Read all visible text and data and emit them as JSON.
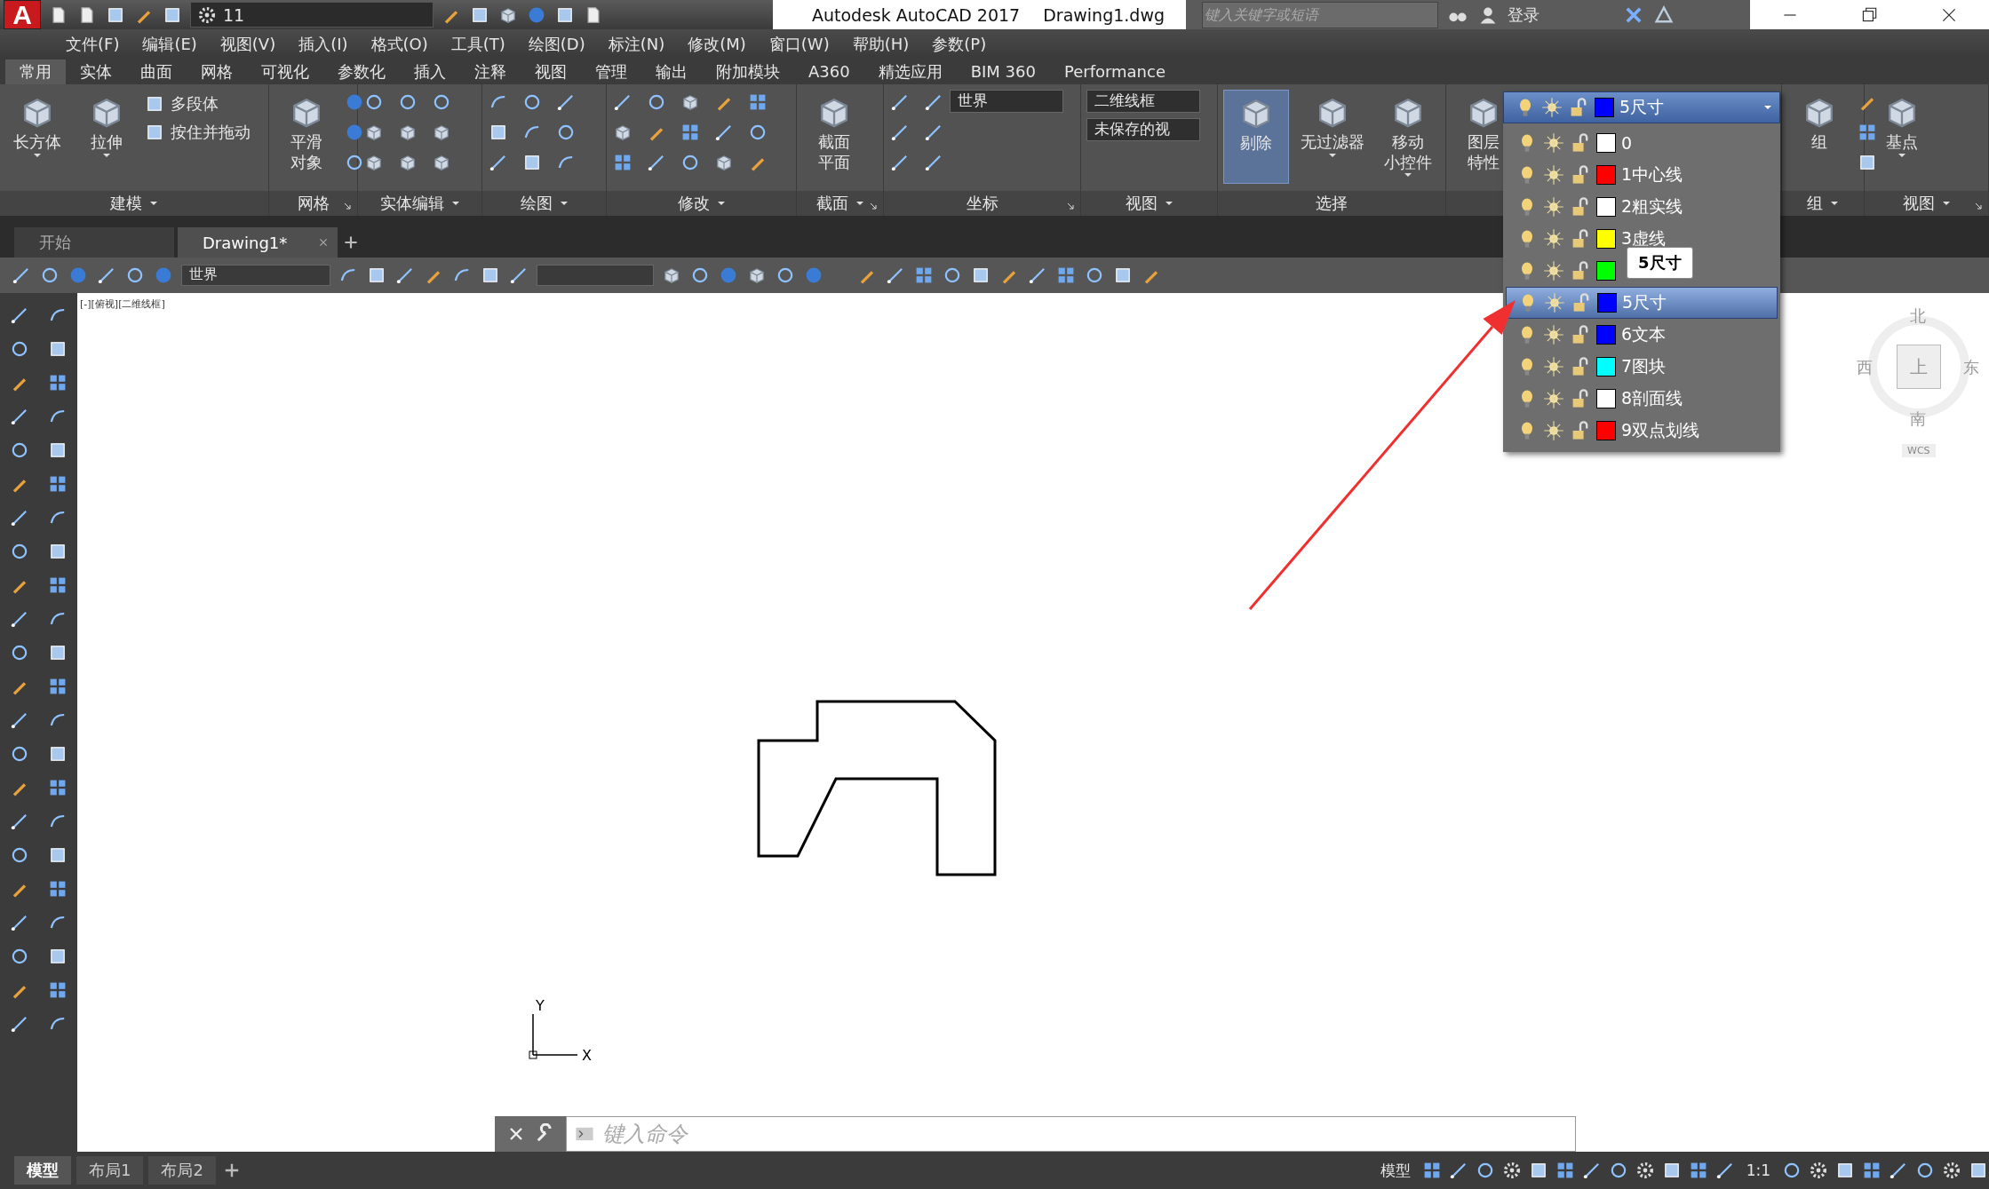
{
  "title_bar": {
    "logo": "A",
    "workspace": "11",
    "app_title": "Autodesk AutoCAD 2017",
    "document": "Drawing1.dwg",
    "search": {
      "placeholder": "键入关键字或短语"
    },
    "user": "登录"
  },
  "menu": [
    "文件(F)",
    "编辑(E)",
    "视图(V)",
    "插入(I)",
    "格式(O)",
    "工具(T)",
    "绘图(D)",
    "标注(N)",
    "修改(M)",
    "窗口(W)",
    "帮助(H)",
    "参数(P)"
  ],
  "ribbon_tabs": [
    {
      "label": "常用",
      "selected": true
    },
    {
      "label": "实体",
      "selected": false
    },
    {
      "label": "曲面",
      "selected": false
    },
    {
      "label": "网格",
      "selected": false
    },
    {
      "label": "可视化",
      "selected": false
    },
    {
      "label": "参数化",
      "selected": false
    },
    {
      "label": "插入",
      "selected": false
    },
    {
      "label": "注释",
      "selected": false
    },
    {
      "label": "视图",
      "selected": false
    },
    {
      "label": "管理",
      "selected": false
    },
    {
      "label": "输出",
      "selected": false
    },
    {
      "label": "附加模块",
      "selected": false
    },
    {
      "label": "A360",
      "selected": false
    },
    {
      "label": "精选应用",
      "selected": false
    },
    {
      "label": "BIM 360",
      "selected": false
    },
    {
      "label": "Performance",
      "selected": false
    }
  ],
  "ribbon_panels": [
    {
      "kind": "modeling",
      "title": "建模",
      "dropdown": true,
      "launcher": false,
      "large": [
        {
          "lines": [
            "长方体"
          ],
          "active": false,
          "caret": true
        },
        {
          "lines": [
            "拉伸"
          ],
          "active": false,
          "caret": true
        }
      ],
      "small": [
        "多段体",
        "按住并拖动"
      ]
    },
    {
      "kind": "mesh",
      "title": "网格",
      "dropdown": false,
      "launcher": true,
      "large": [
        {
          "lines": [
            "平滑",
            "对象"
          ],
          "active": false,
          "caret": false
        }
      ]
    },
    {
      "kind": "solid-edit",
      "title": "实体编辑",
      "dropdown": true,
      "launcher": false
    },
    {
      "kind": "draw",
      "title": "绘图",
      "dropdown": true,
      "launcher": false
    },
    {
      "kind": "modify",
      "title": "修改",
      "dropdown": true,
      "launcher": false
    },
    {
      "kind": "section",
      "title": "截面",
      "dropdown": true,
      "launcher": true,
      "large": [
        {
          "lines": [
            "截面",
            "平面"
          ],
          "active": false,
          "caret": false
        }
      ]
    },
    {
      "kind": "coords",
      "title": "坐标",
      "dropdown": false,
      "launcher": true,
      "selects": [
        "世界"
      ]
    },
    {
      "kind": "view",
      "title": "视图",
      "dropdown": true,
      "launcher": false,
      "selects": [
        "二维线框",
        "未保存的视"
      ]
    },
    {
      "kind": "selection",
      "title": "选择",
      "dropdown": false,
      "launcher": false,
      "large": [
        {
          "lines": [
            "剔除"
          ],
          "active": true,
          "caret": false
        },
        {
          "lines": [
            "无过滤器"
          ],
          "active": false,
          "caret": true
        },
        {
          "lines": [
            "移动",
            "小控件"
          ],
          "active": false,
          "caret": true
        }
      ]
    },
    {
      "kind": "layers",
      "large": [
        {
          "lines": [
            "图层",
            "特性"
          ],
          "active": false,
          "caret": false
        }
      ]
    },
    {
      "kind": "group",
      "title": "组",
      "dropdown": true,
      "launcher": false,
      "large": [
        {
          "lines": [
            "组"
          ],
          "active": false,
          "caret": false
        }
      ]
    },
    {
      "kind": "view-block",
      "title": "视图",
      "dropdown": true,
      "launcher": true,
      "large": [
        {
          "lines": [
            "基点"
          ],
          "active": false,
          "caret": true
        }
      ]
    }
  ],
  "layer_control": {
    "current": {
      "name": "5尺寸",
      "color": "#0000ff"
    },
    "layers": [
      {
        "name": "0",
        "color": "#ffffff",
        "selected": false
      },
      {
        "name": "1中心线",
        "color": "#ff0000",
        "selected": false
      },
      {
        "name": "2粗实线",
        "color": "#ffffff",
        "selected": false
      },
      {
        "name": "3虚线",
        "color": "#ffff00",
        "selected": false
      },
      {
        "color": "#00ff00",
        "selected": false
      },
      {
        "name": "5尺寸",
        "color": "#0000ff",
        "selected": true
      },
      {
        "name": "6文本",
        "color": "#0000ff",
        "selected": false
      },
      {
        "name": "7图块",
        "color": "#00ffff",
        "selected": false
      },
      {
        "name": "8剖面线",
        "color": "#ffffff",
        "selected": false
      },
      {
        "name": "9双点划线",
        "color": "#ff0000",
        "selected": false
      }
    ],
    "tooltip": "5尺寸"
  },
  "file_tabs": [
    {
      "label": "开始",
      "selected": false
    },
    {
      "label": "Drawing1*",
      "selected": true
    }
  ],
  "toolbar": {
    "ucs": "世界"
  },
  "viewport_label": "[-][俯视][二维线框]",
  "view_cube": {
    "top": "上",
    "north": "北",
    "south": "南",
    "west": "西",
    "east": "东",
    "wcs": "WCS"
  },
  "ucs": {
    "x": "X",
    "y": "Y"
  },
  "command_line": {
    "placeholder": "键入命令"
  },
  "layout_tabs": [
    {
      "label": "模型",
      "selected": true
    },
    {
      "label": "布局1",
      "selected": false
    },
    {
      "label": "布局2",
      "selected": false
    }
  ],
  "status_bar": {
    "model": "模型",
    "scale": "1:1"
  }
}
